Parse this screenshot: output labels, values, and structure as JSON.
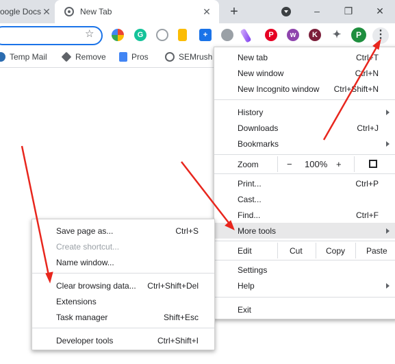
{
  "tabs": [
    {
      "title": "oogle Docs"
    },
    {
      "title": "New Tab"
    }
  ],
  "window_controls": {
    "new_tab": "+",
    "minimize": "–",
    "maximize": "❐",
    "close": "✕"
  },
  "toolbar": {
    "star": "☆",
    "menu": "⋮",
    "profile_initial": "P",
    "ext_k": "K"
  },
  "bookmarks": [
    {
      "label": "Temp Mail",
      "icon": "temp-mail-icon"
    },
    {
      "label": "Remove",
      "icon": "layers-icon"
    },
    {
      "label": "Pros",
      "icon": "doc-icon"
    },
    {
      "label": "SEMrush",
      "icon": "globe-icon"
    }
  ],
  "menu": {
    "new_tab": {
      "label": "New tab",
      "shortcut": "Ctrl+T"
    },
    "new_window": {
      "label": "New window",
      "shortcut": "Ctrl+N"
    },
    "new_incognito": {
      "label": "New Incognito window",
      "shortcut": "Ctrl+Shift+N"
    },
    "history": {
      "label": "History"
    },
    "downloads": {
      "label": "Downloads",
      "shortcut": "Ctrl+J"
    },
    "bookmarks": {
      "label": "Bookmarks"
    },
    "zoom": {
      "label": "Zoom",
      "minus": "−",
      "value": "100%",
      "plus": "+"
    },
    "print": {
      "label": "Print...",
      "shortcut": "Ctrl+P"
    },
    "cast": {
      "label": "Cast..."
    },
    "find": {
      "label": "Find...",
      "shortcut": "Ctrl+F"
    },
    "more_tools": {
      "label": "More tools"
    },
    "edit": {
      "label": "Edit",
      "cut": "Cut",
      "copy": "Copy",
      "paste": "Paste"
    },
    "settings": {
      "label": "Settings"
    },
    "help": {
      "label": "Help"
    },
    "exit": {
      "label": "Exit"
    }
  },
  "submenu": {
    "save_page": {
      "label": "Save page as...",
      "shortcut": "Ctrl+S"
    },
    "create_shortcut": {
      "label": "Create shortcut..."
    },
    "name_window": {
      "label": "Name window..."
    },
    "clear_browsing": {
      "label": "Clear browsing data...",
      "shortcut": "Ctrl+Shift+Del"
    },
    "extensions": {
      "label": "Extensions"
    },
    "task_manager": {
      "label": "Task manager",
      "shortcut": "Shift+Esc"
    },
    "developer_tools": {
      "label": "Developer tools",
      "shortcut": "Ctrl+Shift+I"
    }
  },
  "colors": {
    "accent": "#1a73e8",
    "annotation_arrow": "#e8261d",
    "hover": "#e8e8e9"
  }
}
